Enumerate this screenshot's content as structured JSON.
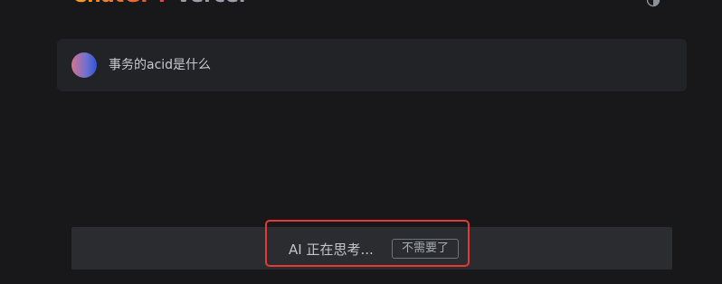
{
  "header": {
    "brand": "ChatGPT",
    "brand_suffix": "Vercel"
  },
  "conversation": {
    "message_text": "事务的acid是什么"
  },
  "status": {
    "text": "AI 正在思考...",
    "cancel_label": "不需要了"
  },
  "icons": {
    "theme_toggle": "theme-toggle-icon",
    "avatar": "avatar"
  },
  "colors": {
    "background": "#18181b",
    "card": "#222327",
    "status_bar": "#2a2c30",
    "highlight": "#e53935"
  }
}
